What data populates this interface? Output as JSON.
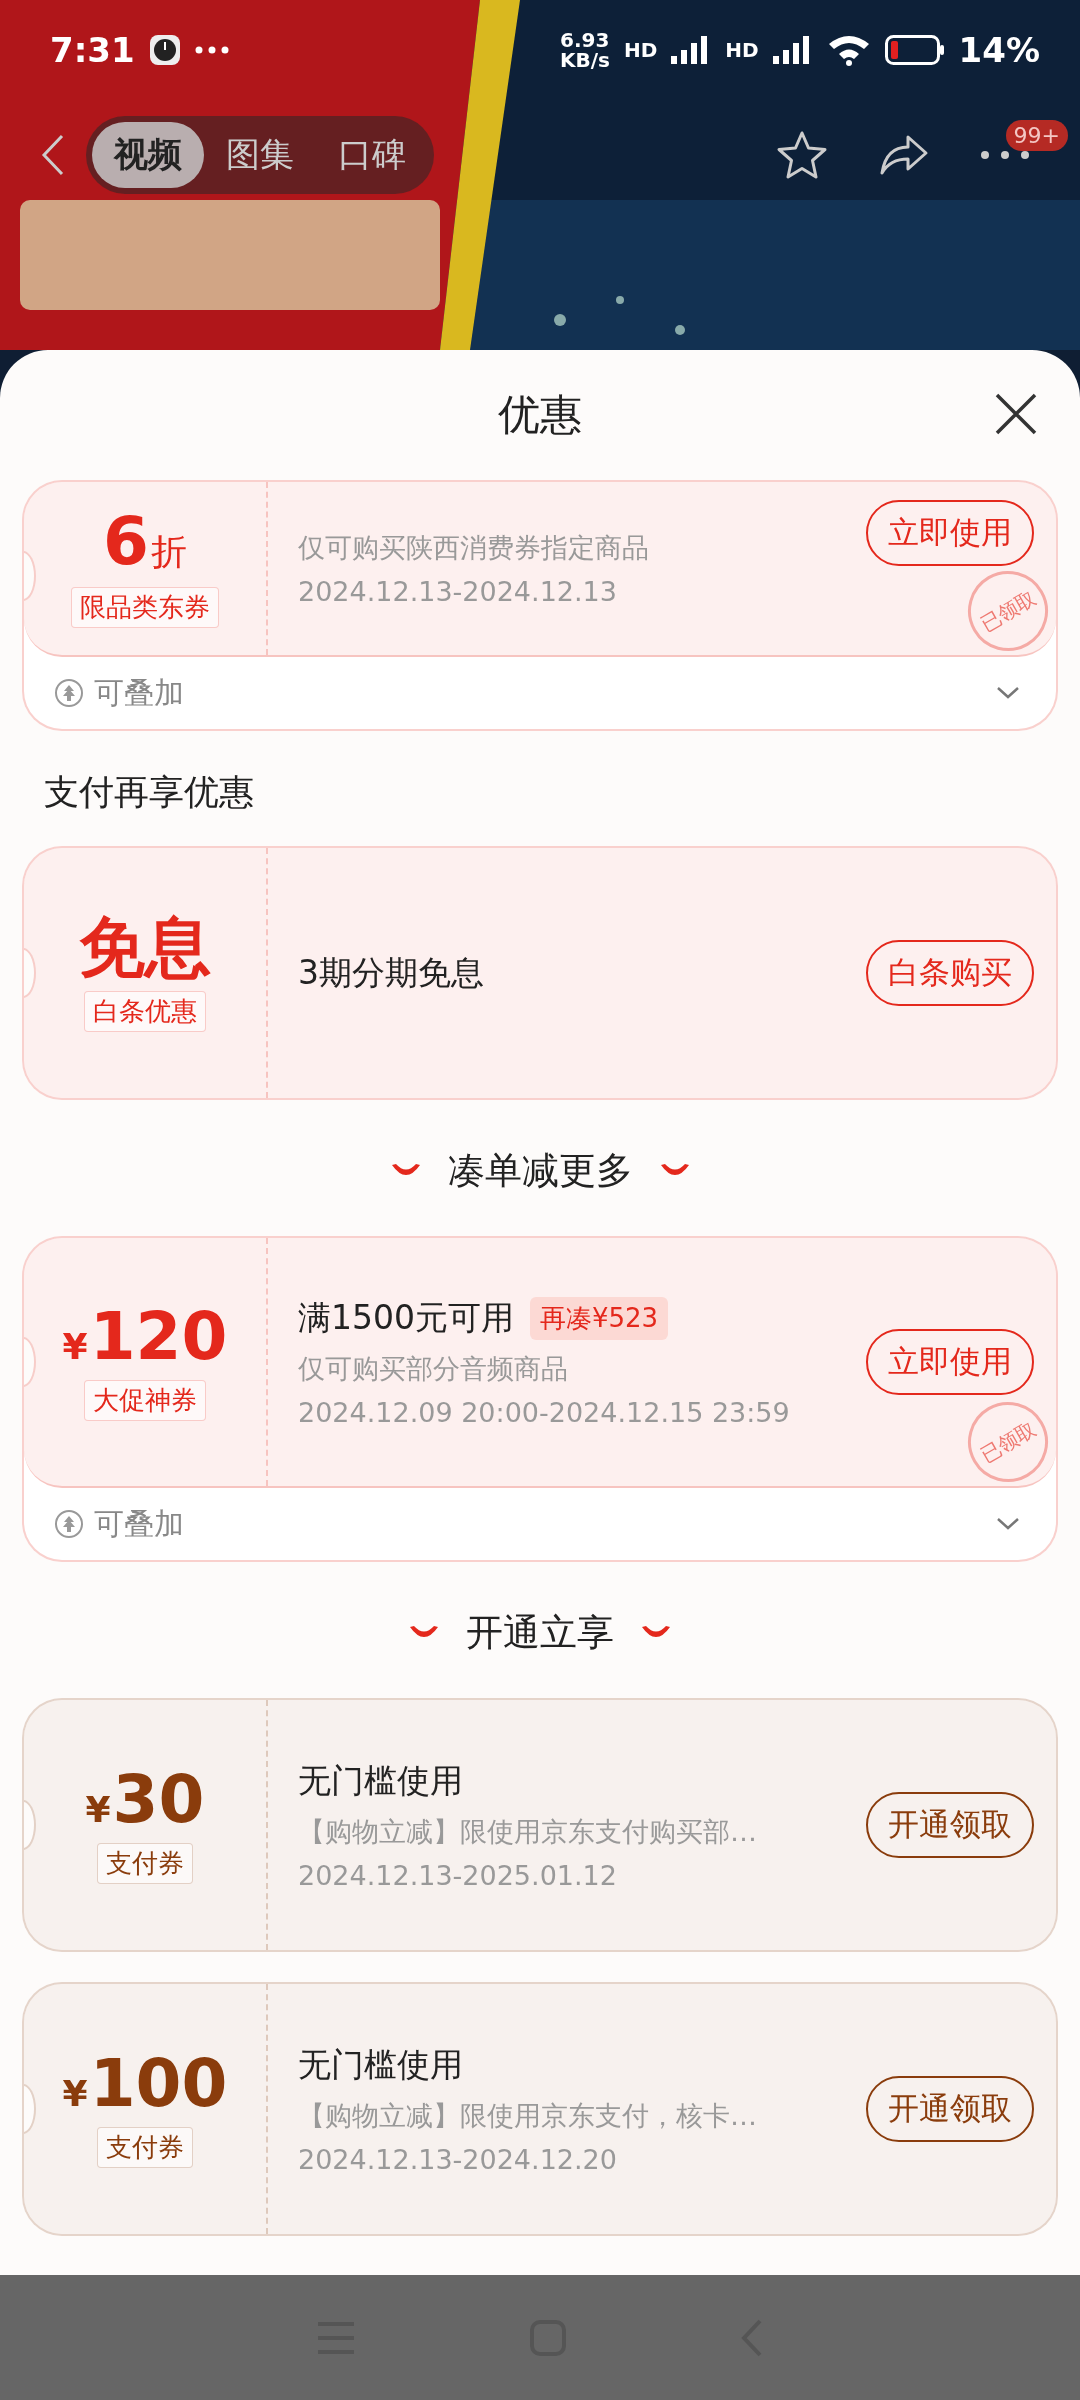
{
  "status_bar": {
    "time": "7:31",
    "net_speed": "6.93",
    "net_unit": "KB/s",
    "signal_1": "HD",
    "signal_2": "HD",
    "battery": "14%"
  },
  "top_nav": {
    "tabs": [
      {
        "label": "视频",
        "selected": true
      },
      {
        "label": "图集",
        "selected": false
      },
      {
        "label": "口碑",
        "selected": false
      }
    ],
    "badge": "99+"
  },
  "sheet": {
    "title": "优惠"
  },
  "items": [
    {
      "kind": "coupon",
      "color": "#e4281c",
      "amount": "6",
      "unit": "折",
      "tag": "限品类东券",
      "desc": "仅可购买陕西消费券指定商品",
      "date": "2024.12.13-2024.12.13",
      "button": "立即使用",
      "stamp": "已领取",
      "stack": "可叠加"
    },
    {
      "kind": "heading",
      "text": "支付再享优惠"
    },
    {
      "kind": "coupon",
      "color": "#e4281c",
      "amount": "免息",
      "tag": "白条优惠",
      "title": "3期分期免息",
      "button": "白条购买"
    },
    {
      "kind": "banner_heading",
      "text": "凑单减更多"
    },
    {
      "kind": "coupon",
      "color": "#e4281c",
      "currency": "¥",
      "amount": "120",
      "tag": "大促神券",
      "title": "满1500元可用",
      "extra": "再凑¥523",
      "desc": "仅可购买部分音频商品",
      "date": "2024.12.09 20:00-2024.12.15 23:59",
      "button": "立即使用",
      "stamp": "已领取",
      "stack": "可叠加"
    },
    {
      "kind": "banner_heading",
      "text": "开通立享"
    },
    {
      "kind": "coupon",
      "color": "#8a3c0c",
      "currency": "¥",
      "amount": "30",
      "tag": "支付券",
      "title": "无门槛使用",
      "desc": "【购物立减】限使用京东支付购买部…",
      "date": "2024.12.13-2025.01.12",
      "button": "开通领取"
    },
    {
      "kind": "coupon",
      "color": "#8a3c0c",
      "currency": "¥",
      "amount": "100",
      "tag": "支付券",
      "title": "无门槛使用",
      "desc": "【购物立减】限使用京东支付，核卡…",
      "date": "2024.12.13-2024.12.20",
      "button": "开通领取"
    }
  ]
}
